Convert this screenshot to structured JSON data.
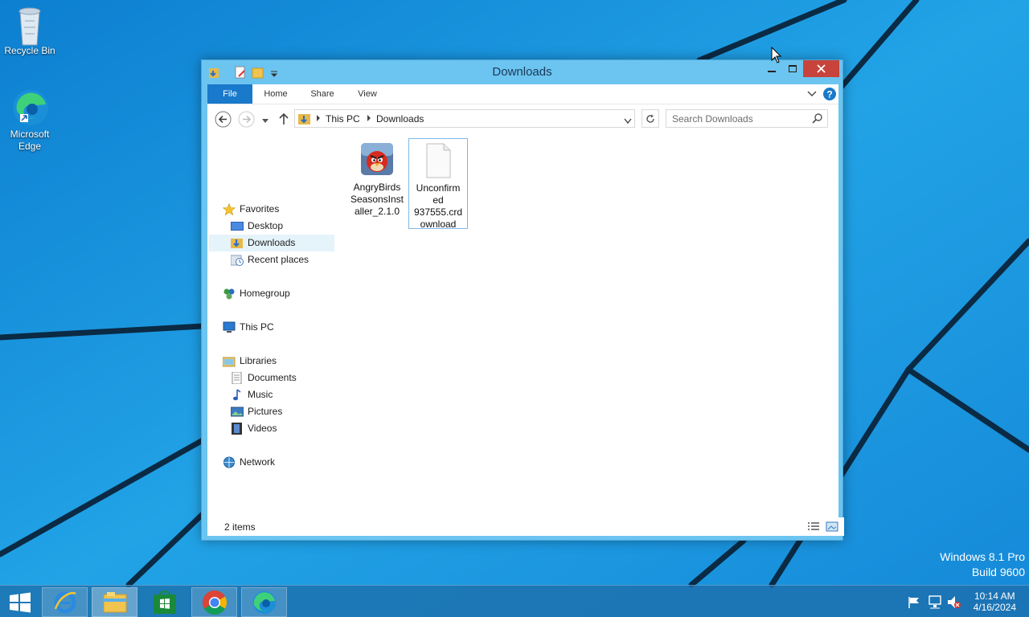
{
  "desktop": {
    "icons": [
      {
        "label": "Recycle Bin"
      },
      {
        "label": "Microsoft Edge"
      }
    ],
    "watermark": {
      "line1": "Windows 8.1 Pro",
      "line2": "Build 9600"
    }
  },
  "window": {
    "title": "Downloads",
    "ribbon_tabs": [
      "File",
      "Home",
      "Share",
      "View"
    ],
    "address": {
      "segments": [
        "This PC",
        "Downloads"
      ]
    },
    "search": {
      "placeholder": "Search Downloads"
    },
    "nav_pane": {
      "favorites": {
        "label": "Favorites",
        "items": [
          "Desktop",
          "Downloads",
          "Recent places"
        ]
      },
      "homegroup": "Homegroup",
      "this_pc": "This PC",
      "libraries": {
        "label": "Libraries",
        "items": [
          "Documents",
          "Music",
          "Pictures",
          "Videos"
        ]
      },
      "network": "Network"
    },
    "files": [
      {
        "name": "AngryBirdsSeasonsInstaller_2.1.0",
        "lines": [
          "AngryBirds",
          "SeasonsInst",
          "aller_2.1.0"
        ]
      },
      {
        "name": "Unconfirmed 937555.crdownload",
        "lines": [
          "Unconfirm",
          "ed",
          "937555.crd",
          "ownload"
        ]
      }
    ],
    "status": "2 items"
  },
  "taskbar": {
    "clock": {
      "time": "10:14 AM",
      "date": "4/16/2024"
    }
  },
  "colors": {
    "accent": "#1979ca",
    "close": "#c7433c",
    "frame": "#6cc4f0"
  }
}
